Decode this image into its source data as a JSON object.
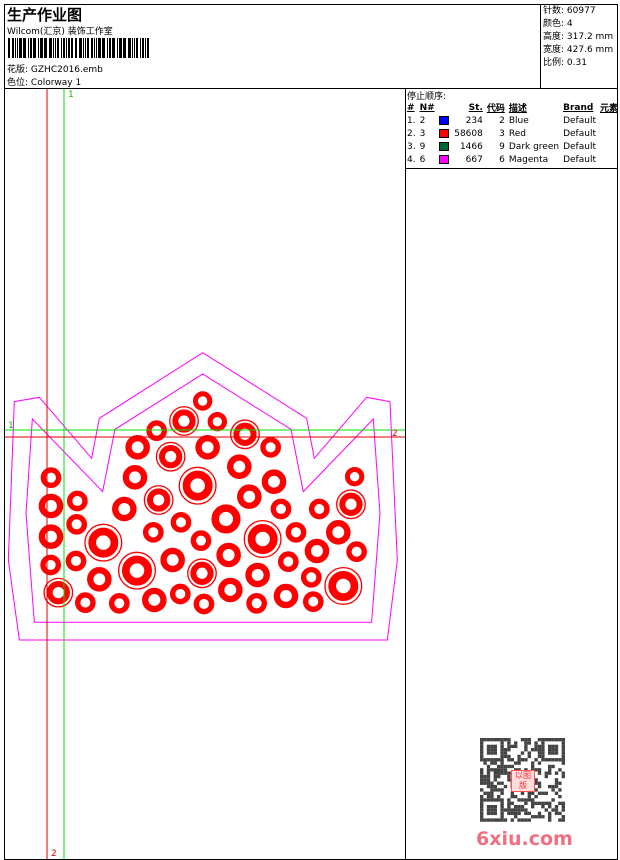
{
  "header": {
    "title": "生产作业图",
    "company": "Wilcom(汇京) 装饰工作室",
    "design_label": "花版:",
    "design_value": "GZHC2016.emb",
    "colorway_label": "色位:",
    "colorway_value": "Colorway 1"
  },
  "info": [
    {
      "label": "针数:",
      "value": "60977"
    },
    {
      "label": "颜色:",
      "value": "4"
    },
    {
      "label": "高度:",
      "value": "317.2 mm"
    },
    {
      "label": "宽度:",
      "value": "427.6 mm"
    },
    {
      "label": "比例:",
      "value": "0.31"
    }
  ],
  "stop_sequence": {
    "title": "停止顺序:",
    "headers": [
      "#",
      "N#",
      "St.",
      "代码",
      "描述",
      "Brand",
      "元素"
    ],
    "rows": [
      {
        "idx": "1.",
        "n": "2",
        "color": "#0000ff",
        "st": "234",
        "code": "2",
        "desc": "Blue",
        "brand": "Default"
      },
      {
        "idx": "2.",
        "n": "3",
        "color": "#ff0000",
        "st": "58608",
        "code": "3",
        "desc": "Red",
        "brand": "Default"
      },
      {
        "idx": "3.",
        "n": "9",
        "color": "#006633",
        "st": "1466",
        "code": "9",
        "desc": "Dark green",
        "brand": "Default"
      },
      {
        "idx": "4.",
        "n": "6",
        "color": "#ff00ff",
        "st": "667",
        "code": "6",
        "desc": "Magenta",
        "brand": "Default"
      }
    ]
  },
  "canvas": {
    "marker_green_top": "1",
    "marker_green_left": "1",
    "marker_red_right": "2",
    "marker_red_bottom": "2"
  },
  "watermark": {
    "text": "6xiu.com",
    "stamp": "以图版"
  }
}
